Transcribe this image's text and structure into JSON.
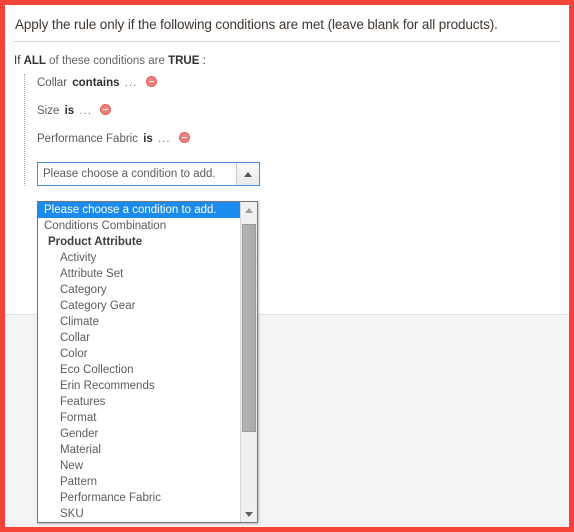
{
  "theme": {
    "annotation_border_color": "#f4443a",
    "highlight_color": "#1b8ced",
    "delete_icon_color": "#f0817c",
    "page_background": "#ffffff",
    "lower_band_background": "#f4f4f4"
  },
  "section": {
    "title": "Apply the rule only if the following conditions are met (leave blank for all products).",
    "if_line": {
      "prefix": "If",
      "aggregator": "ALL",
      "middle": "of these conditions are",
      "value": "TRUE",
      "suffix": ":"
    },
    "conditions": [
      {
        "attribute": "Collar",
        "operator": "contains",
        "value": "...",
        "remove_label": "Remove condition"
      },
      {
        "attribute": "Size",
        "operator": "is",
        "value": "...",
        "remove_label": "Remove condition"
      },
      {
        "attribute": "Performance Fabric",
        "operator": "is",
        "value": "...",
        "remove_label": "Remove condition"
      }
    ]
  },
  "condition_select": {
    "selected_value": "Please choose a condition to add.",
    "expanded": true,
    "toggle_icon": "caret-up-icon",
    "options": [
      {
        "label": "Please choose a condition to add.",
        "type": "option",
        "selected": true
      },
      {
        "label": "Conditions Combination",
        "type": "option",
        "selected": false
      },
      {
        "label": "Product Attribute",
        "type": "group",
        "selected": false
      },
      {
        "label": "Activity",
        "type": "child",
        "selected": false
      },
      {
        "label": "Attribute Set",
        "type": "child",
        "selected": false
      },
      {
        "label": "Category",
        "type": "child",
        "selected": false
      },
      {
        "label": "Category Gear",
        "type": "child",
        "selected": false
      },
      {
        "label": "Climate",
        "type": "child",
        "selected": false
      },
      {
        "label": "Collar",
        "type": "child",
        "selected": false
      },
      {
        "label": "Color",
        "type": "child",
        "selected": false
      },
      {
        "label": "Eco Collection",
        "type": "child",
        "selected": false
      },
      {
        "label": "Erin Recommends",
        "type": "child",
        "selected": false
      },
      {
        "label": "Features",
        "type": "child",
        "selected": false
      },
      {
        "label": "Format",
        "type": "child",
        "selected": false
      },
      {
        "label": "Gender",
        "type": "child",
        "selected": false
      },
      {
        "label": "Material",
        "type": "child",
        "selected": false
      },
      {
        "label": "New",
        "type": "child",
        "selected": false
      },
      {
        "label": "Pattern",
        "type": "child",
        "selected": false
      },
      {
        "label": "Performance Fabric",
        "type": "child",
        "selected": false
      },
      {
        "label": "SKU",
        "type": "child",
        "selected": false
      }
    ],
    "scrollbar": {
      "up_icon": "scroll-up-arrow-icon",
      "down_icon": "scroll-down-arrow-icon"
    }
  }
}
